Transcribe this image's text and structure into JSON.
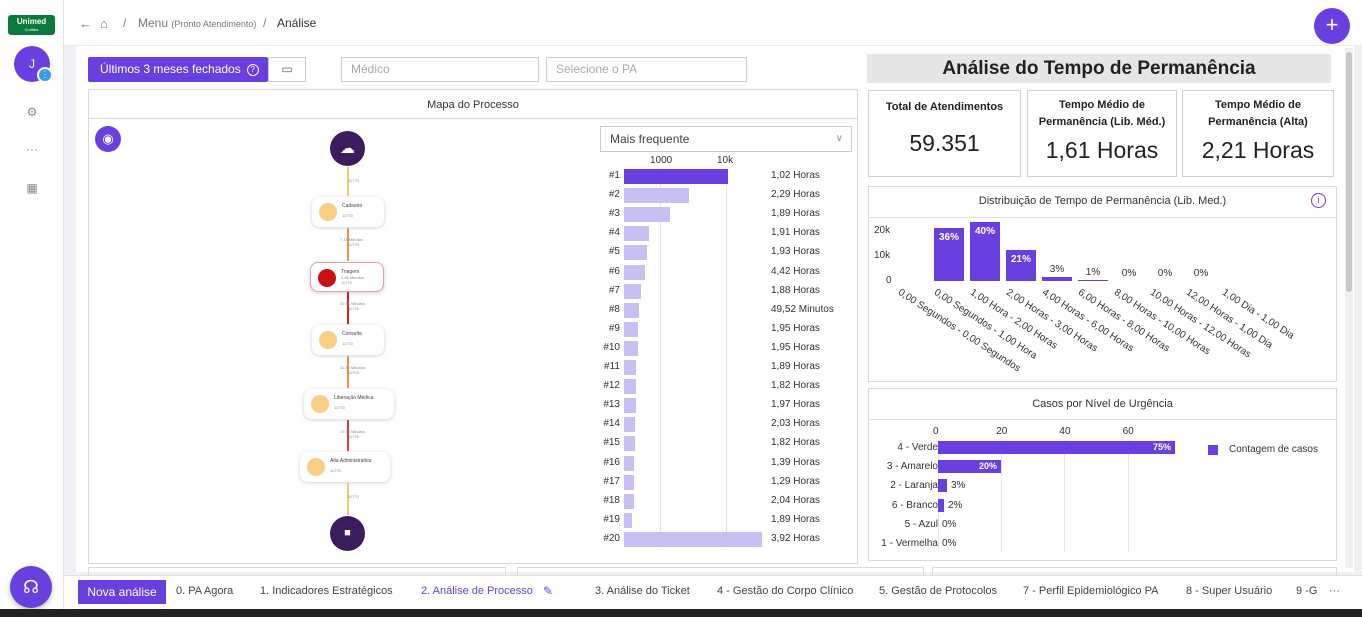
{
  "sidebar": {
    "logo_text": "Unimed",
    "logo_subtext": "Curitiba",
    "avatar_initial": "J",
    "avatar_dot": "⋮",
    "icons": [
      "gear-icon",
      "more-icon",
      "building-icon"
    ],
    "colors": {
      "accent": "#6a3fe0",
      "logo": "#0a7a3d"
    }
  },
  "breadcrumb": {
    "menu": "Menu",
    "menu_sub": "(Pronto Atendimento)",
    "current": "Análise",
    "separator": "/"
  },
  "filters": {
    "period_label": "Últimos 3 meses fechados",
    "help_glyph": "?",
    "medico_placeholder": "Médico",
    "pa_placeholder": "Selecione o PA"
  },
  "process": {
    "title": "Mapa do Processo",
    "sort_label": "Mais frequente",
    "axis_labels": [
      "1000",
      "10k"
    ],
    "nodes": [
      {
        "name": "Cadastro",
        "count": "11770"
      },
      {
        "name": "Triagem",
        "time": "2,55 Minutos",
        "count": "11770"
      },
      {
        "name": "Consulta",
        "count": "11770"
      },
      {
        "name": "Liberação Médica",
        "count": "11770"
      },
      {
        "name": "Alta Administrativa",
        "count": "11770"
      }
    ],
    "edges": [
      {
        "time": "",
        "count": "11770"
      },
      {
        "time": "7,13 Minutos",
        "count": "11770"
      },
      {
        "time": "22,81 Minutos",
        "count": "11770"
      },
      {
        "time": "11,32 Minutos",
        "count": "11770"
      },
      {
        "time": "17,69 Minutos",
        "count": "11770"
      },
      {
        "time": "",
        "count": "11770"
      }
    ],
    "variants": [
      {
        "rank": "#1",
        "value": "1,02 Horas",
        "freq": 0.75
      },
      {
        "rank": "#2",
        "value": "2,29 Horas",
        "freq": 0.47
      },
      {
        "rank": "#3",
        "value": "1,89 Horas",
        "freq": 0.33
      },
      {
        "rank": "#4",
        "value": "1,91 Horas",
        "freq": 0.18
      },
      {
        "rank": "#5",
        "value": "1,93 Horas",
        "freq": 0.17
      },
      {
        "rank": "#6",
        "value": "4,42 Horas",
        "freq": 0.15
      },
      {
        "rank": "#7",
        "value": "1,88 Horas",
        "freq": 0.12
      },
      {
        "rank": "#8",
        "value": "49,52 Minutos",
        "freq": 0.11
      },
      {
        "rank": "#9",
        "value": "1,95 Horas",
        "freq": 0.1
      },
      {
        "rank": "#10",
        "value": "1,95 Horas",
        "freq": 0.1
      },
      {
        "rank": "#11",
        "value": "1,89 Horas",
        "freq": 0.09
      },
      {
        "rank": "#12",
        "value": "1,82 Horas",
        "freq": 0.09
      },
      {
        "rank": "#13",
        "value": "1,97 Horas",
        "freq": 0.09
      },
      {
        "rank": "#14",
        "value": "2,03 Horas",
        "freq": 0.08
      },
      {
        "rank": "#15",
        "value": "1,82 Horas",
        "freq": 0.08
      },
      {
        "rank": "#16",
        "value": "1,39 Horas",
        "freq": 0.07
      },
      {
        "rank": "#17",
        "value": "1,29 Horas",
        "freq": 0.07
      },
      {
        "rank": "#18",
        "value": "2,04 Horas",
        "freq": 0.07
      },
      {
        "rank": "#19",
        "value": "1,89 Horas",
        "freq": 0.06
      },
      {
        "rank": "#20",
        "value": "3,92 Horas",
        "freq": 1.0
      }
    ]
  },
  "kpis": {
    "title": "Análise do Tempo de Permanência",
    "total_label": "Total de Atendimentos",
    "total_value": "59.351",
    "lib_label": "Tempo Médio de Permanência (Lib. Méd.)",
    "lib_value": "1,61 Horas",
    "alta_label": "Tempo Médio de Permanência (Alta)",
    "alta_value": "2,21 Horas"
  },
  "chart_data": [
    {
      "type": "bar",
      "title": "Distribuição de Tempo de Permanência (Lib. Med.)",
      "y_ticks": [
        "20k",
        "10k",
        "0"
      ],
      "ylim": [
        0,
        25000
      ],
      "categories": [
        "0,00 Segundos - 0,00 Segundos",
        "0,00 Segundos - 1,00 Hora",
        "1,00 Hora - 2,00 Horas",
        "2,00 Horas - 3,00 Horas",
        "4,00 Horas - 6,00 Horas",
        "6,00 Horas - 8,00 Horas",
        "8,00 Horas - 10,00 Horas",
        "10,00 Horas - 12,00 Horas",
        "12,00 Horas - 1,00 Dia",
        "1,00 Dia - 1,00 Dia"
      ],
      "values": [
        0,
        21400,
        23800,
        12500,
        1800,
        600,
        120,
        60,
        30,
        15
      ],
      "data_labels": [
        "",
        "36%",
        "40%",
        "21%",
        "3%",
        "1%",
        "0%",
        "0%",
        "0%",
        ""
      ]
    },
    {
      "type": "bar",
      "title": "Casos por Nível de Urgência",
      "orientation": "horizontal",
      "x_ticks": [
        "0",
        "20",
        "40",
        "60"
      ],
      "xlim": [
        0,
        75
      ],
      "legend": "Contagem de casos",
      "categories": [
        "4 - Verde",
        "3 - Amarelo",
        "2 - Laranja",
        "6 - Branco",
        "5 - Azul",
        "1 - Vermelha"
      ],
      "values": [
        75,
        20,
        3,
        2,
        0,
        0
      ],
      "data_labels": [
        "75%",
        "20%",
        "3%",
        "2%",
        "0%",
        "0%"
      ]
    }
  ],
  "tabs": {
    "new_label": "Nova análise",
    "items": [
      "0. PA Agora",
      "1. Indicadores Estratégicos",
      "2. Análise de Processo",
      "3. Análise do Ticket",
      "4 - Gestão do Corpo Clínico",
      "5. Gestão de Protocolos",
      "7 - Perfil Epidemiológico PA",
      "8 - Super Usuário",
      "9 -G"
    ],
    "more": "···"
  }
}
